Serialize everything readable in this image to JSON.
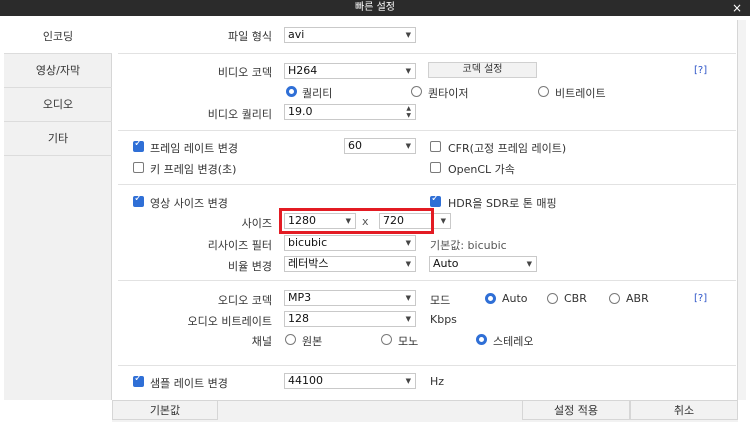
{
  "window": {
    "title": "빠른 설정",
    "close": "×"
  },
  "sidebar": {
    "items": [
      {
        "label": "인코딩"
      },
      {
        "label": "영상/자막"
      },
      {
        "label": "오디오"
      },
      {
        "label": "기타"
      }
    ]
  },
  "format": {
    "label": "파일 형식",
    "value": "avi"
  },
  "video": {
    "codec_label": "비디오 코덱",
    "codec_value": "H264",
    "codec_settings_button": "코덱 설정",
    "help": "[?]",
    "mode_quality": "퀄리티",
    "mode_quantizer": "퀀타이저",
    "mode_bitrate": "비트레이트",
    "quality_label": "비디오 퀄리티",
    "quality_value": "19.0"
  },
  "framerate": {
    "change_label": "프레임 레이트 변경",
    "value": "60",
    "cfr_label": "CFR(고정 프레임 레이트)",
    "keyframe_label": "키 프레임 변경(초)",
    "opencl_label": "OpenCL 가속"
  },
  "resize": {
    "change_label": "영상 사이즈 변경",
    "hdr_label": "HDR을 SDR로 톤 매핑",
    "size_label": "사이즈",
    "width": "1280",
    "x": "x",
    "height": "720",
    "filter_label": "리사이즈 필터",
    "filter_value": "bicubic",
    "filter_default": "기본값: bicubic",
    "ratio_label": "비율 변경",
    "ratio_value": "레터박스",
    "ratio_auto": "Auto"
  },
  "audio": {
    "codec_label": "오디오 코덱",
    "codec_value": "MP3",
    "mode_label": "모드",
    "mode_auto": "Auto",
    "mode_cbr": "CBR",
    "mode_abr": "ABR",
    "help": "[?]",
    "bitrate_label": "오디오 비트레이트",
    "bitrate_value": "128",
    "bitrate_unit": "Kbps",
    "channel_label": "채널",
    "ch_original": "원본",
    "ch_mono": "모노",
    "ch_stereo": "스테레오"
  },
  "sample": {
    "change_label": "샘플 레이트 변경",
    "value": "44100",
    "unit": "Hz"
  },
  "footer": {
    "default_button": "기본값",
    "apply_button": "설정 적용",
    "cancel_button": "취소"
  }
}
